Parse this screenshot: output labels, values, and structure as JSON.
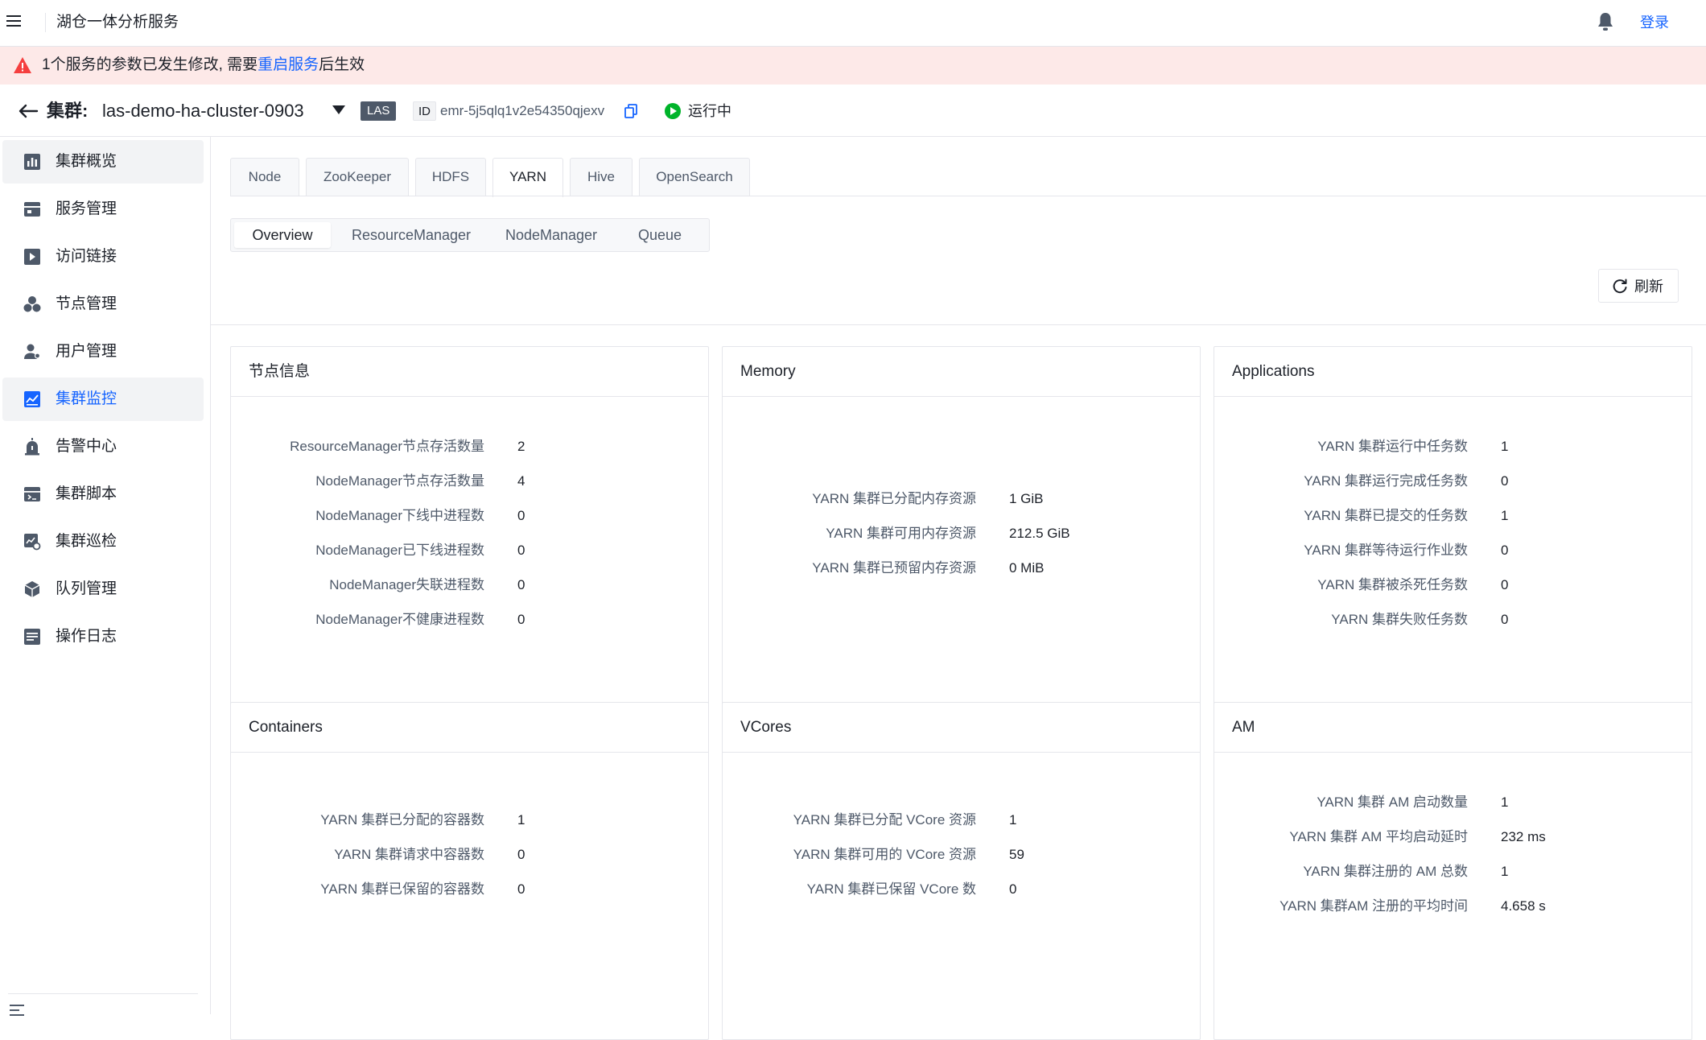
{
  "app": {
    "title": "湖仓一体分析服务",
    "login_label": "登录"
  },
  "alert": {
    "prefix": "1个服务的参数已发生修改, 需要",
    "link": "重启服务",
    "suffix": "后生效"
  },
  "cluster": {
    "label": "集群:",
    "name": "las-demo-ha-cluster-0903",
    "type_badge": "LAS",
    "id_label": "ID",
    "id_value": "emr-5j5qlq1v2e54350qjexv",
    "status": "运行中",
    "status_color": "#00b42a"
  },
  "sidebar": {
    "items": [
      {
        "label": "集群概览",
        "icon": "overview-icon"
      },
      {
        "label": "服务管理",
        "icon": "services-icon"
      },
      {
        "label": "访问链接",
        "icon": "link-icon"
      },
      {
        "label": "节点管理",
        "icon": "nodes-icon"
      },
      {
        "label": "用户管理",
        "icon": "user-icon"
      },
      {
        "label": "集群监控",
        "icon": "monitor-icon"
      },
      {
        "label": "告警中心",
        "icon": "alarm-icon"
      },
      {
        "label": "集群脚本",
        "icon": "script-icon"
      },
      {
        "label": "集群巡检",
        "icon": "inspect-icon"
      },
      {
        "label": "队列管理",
        "icon": "queue-icon"
      },
      {
        "label": "操作日志",
        "icon": "log-icon"
      }
    ],
    "selected": "集群监控"
  },
  "service_tabs": [
    {
      "label": "Node"
    },
    {
      "label": "ZooKeeper"
    },
    {
      "label": "HDFS"
    },
    {
      "label": "YARN"
    },
    {
      "label": "Hive"
    },
    {
      "label": "OpenSearch"
    }
  ],
  "active_service_tab": "YARN",
  "sub_tabs": [
    {
      "label": "Overview"
    },
    {
      "label": "ResourceManager"
    },
    {
      "label": "NodeManager"
    },
    {
      "label": "Queue"
    }
  ],
  "active_sub_tab": "Overview",
  "refresh_label": "刷新",
  "accent_color": "#1664ff",
  "cards": {
    "node_info": {
      "title": "节点信息",
      "rows": [
        {
          "label": "ResourceManager节点存活数量",
          "value": "2"
        },
        {
          "label": "NodeManager节点存活数量",
          "value": "4"
        },
        {
          "label": "NodeManager下线中进程数",
          "value": "0"
        },
        {
          "label": "NodeManager已下线进程数",
          "value": "0"
        },
        {
          "label": "NodeManager失联进程数",
          "value": "0"
        },
        {
          "label": "NodeManager不健康进程数",
          "value": "0"
        }
      ]
    },
    "memory": {
      "title": "Memory",
      "rows": [
        {
          "label": "YARN 集群已分配内存资源",
          "value": "1 GiB"
        },
        {
          "label": "YARN 集群可用内存资源",
          "value": "212.5 GiB"
        },
        {
          "label": "YARN 集群已预留内存资源",
          "value": "0 MiB"
        }
      ]
    },
    "applications": {
      "title": "Applications",
      "rows": [
        {
          "label": "YARN 集群运行中任务数",
          "value": "1"
        },
        {
          "label": "YARN 集群运行完成任务数",
          "value": "0"
        },
        {
          "label": "YARN 集群已提交的任务数",
          "value": "1"
        },
        {
          "label": "YARN 集群等待运行作业数",
          "value": "0"
        },
        {
          "label": "YARN 集群被杀死任务数",
          "value": "0"
        },
        {
          "label": "YARN 集群失败任务数",
          "value": "0"
        }
      ]
    },
    "containers": {
      "title": "Containers",
      "rows": [
        {
          "label": "YARN 集群已分配的容器数",
          "value": "1"
        },
        {
          "label": "YARN 集群请求中容器数",
          "value": "0"
        },
        {
          "label": "YARN 集群已保留的容器数",
          "value": "0"
        }
      ]
    },
    "vcores": {
      "title": "VCores",
      "rows": [
        {
          "label": "YARN 集群已分配 VCore 资源",
          "value": "1"
        },
        {
          "label": "YARN 集群可用的 VCore 资源",
          "value": "59"
        },
        {
          "label": "YARN 集群已保留 VCore 数",
          "value": "0"
        }
      ]
    },
    "am": {
      "title": "AM",
      "rows": [
        {
          "label": "YARN 集群 AM 启动数量",
          "value": "1"
        },
        {
          "label": "YARN 集群 AM 平均启动延时",
          "value": "232 ms"
        },
        {
          "label": "YARN 集群注册的 AM 总数",
          "value": "1"
        },
        {
          "label": "YARN 集群AM 注册的平均时间",
          "value": "4.658 s"
        }
      ]
    }
  }
}
